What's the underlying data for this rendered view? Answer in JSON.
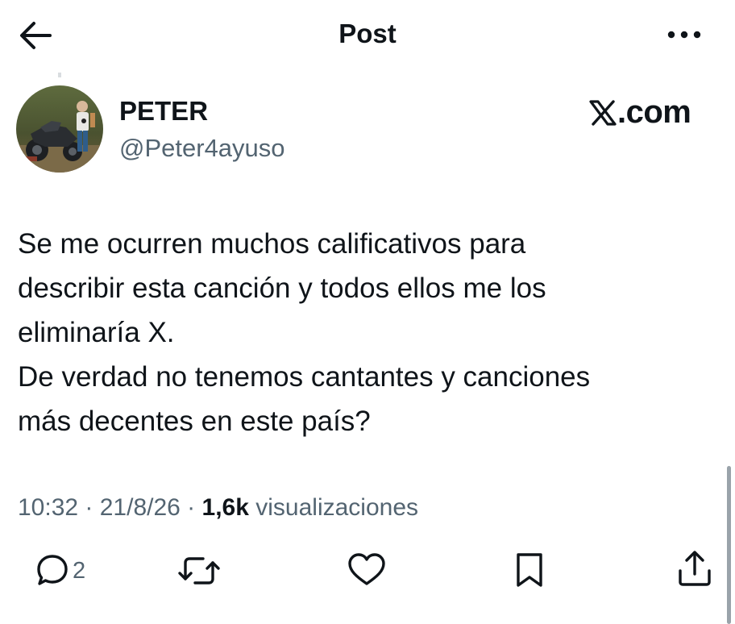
{
  "header": {
    "title": "Post",
    "back_icon": "arrow-left-icon",
    "more_icon": "more-horizontal-icon"
  },
  "author": {
    "display_name": "PETER",
    "handle": "@Peter4ayuso",
    "avatar": "profile-photo-motorcycle"
  },
  "brand": {
    "x_logo": "𝕏",
    "suffix": ".com"
  },
  "post": {
    "text": "Se me ocurren muchos calificativos para\ndescribir esta canción y todos ellos me los\neliminaría X.\nDe verdad no tenemos cantantes y canciones\nmás decentes en este país?"
  },
  "meta": {
    "time": "10:32",
    "separator": " · ",
    "date": "21/8/26",
    "views_count": "1,6k",
    "views_label": "visualizaciones"
  },
  "actions": {
    "reply_count": "2",
    "reply_icon": "reply-icon",
    "repost_icon": "repost-icon",
    "like_icon": "heart-icon",
    "bookmark_icon": "bookmark-icon",
    "share_icon": "share-icon"
  },
  "colors": {
    "text": "#0f1419",
    "secondary": "#536471",
    "background": "#ffffff"
  }
}
